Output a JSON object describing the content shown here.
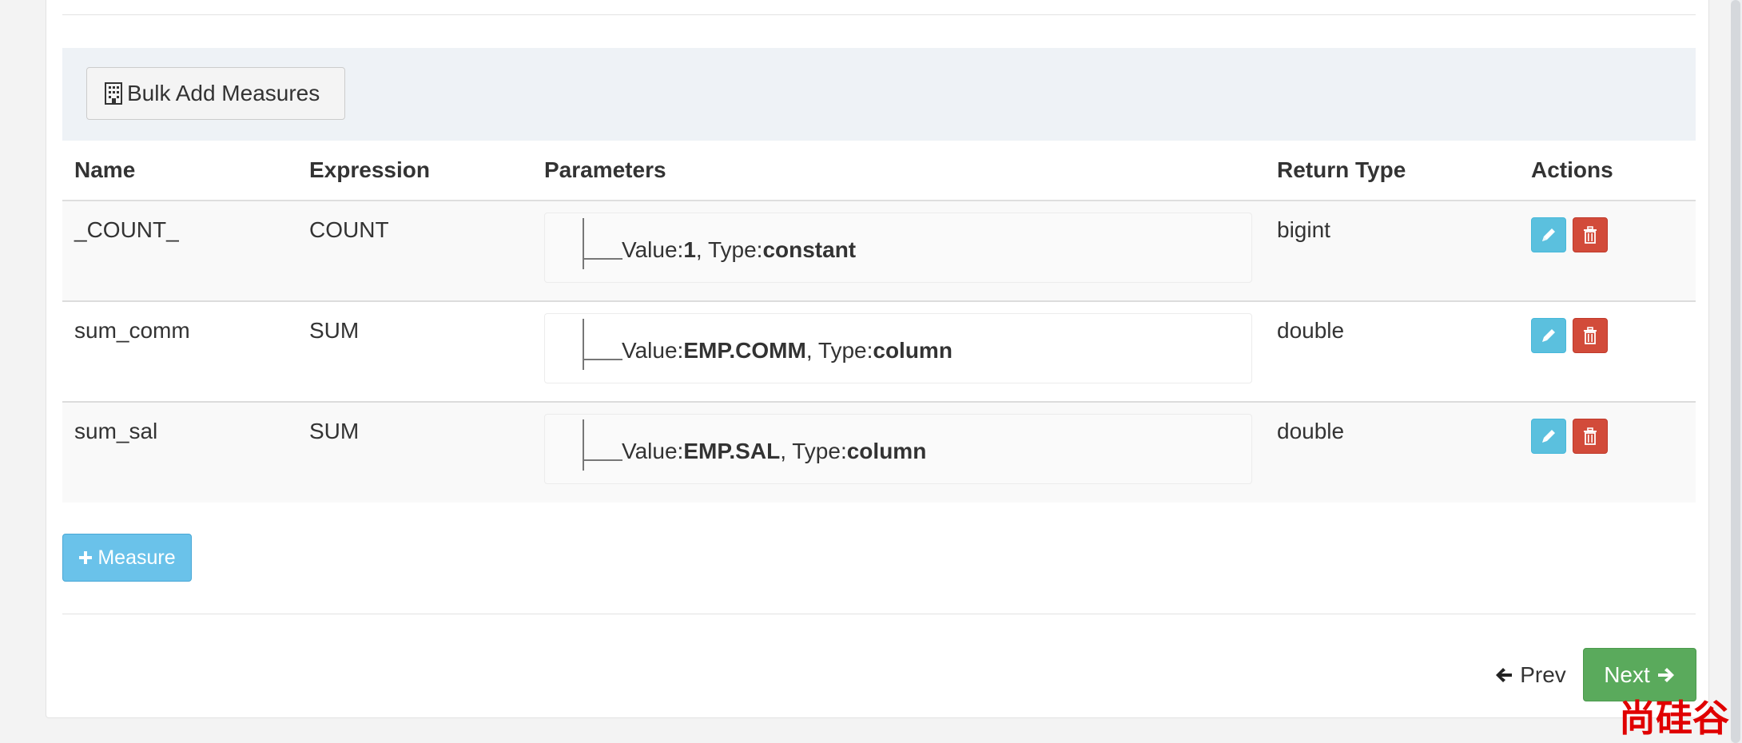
{
  "toolbar": {
    "bulk_add_label": "Bulk Add Measures"
  },
  "table": {
    "headers": [
      "Name",
      "Expression",
      "Parameters",
      "Return Type",
      "Actions"
    ],
    "rows": [
      {
        "name": "_COUNT_",
        "expression": "COUNT",
        "param_value_label": "Value:",
        "param_value": "1",
        "param_sep": ", Type:",
        "param_type": "constant",
        "return_type": "bigint"
      },
      {
        "name": "sum_comm",
        "expression": "SUM",
        "param_value_label": "Value:",
        "param_value": "EMP.COMM",
        "param_sep": ", Type:",
        "param_type": "column",
        "return_type": "double"
      },
      {
        "name": "sum_sal",
        "expression": "SUM",
        "param_value_label": "Value:",
        "param_value": "EMP.SAL",
        "param_sep": ", Type:",
        "param_type": "column",
        "return_type": "double"
      }
    ]
  },
  "add_measure_label": "Measure",
  "nav": {
    "prev_label": "Prev",
    "next_label": "Next"
  },
  "watermark": "尚硅谷",
  "colors": {
    "edit": "#5bc0de",
    "delete": "#d24b3a",
    "next": "#5aaa5c",
    "add_measure": "#6ac2ea",
    "toolbar_bg": "#eef2f6",
    "watermark": "#e00000"
  },
  "icons": {
    "bulk": "building-icon",
    "edit": "pencil-icon",
    "delete": "trash-icon",
    "add": "plus-icon",
    "prev": "arrow-left-icon",
    "next": "arrow-right-icon"
  }
}
